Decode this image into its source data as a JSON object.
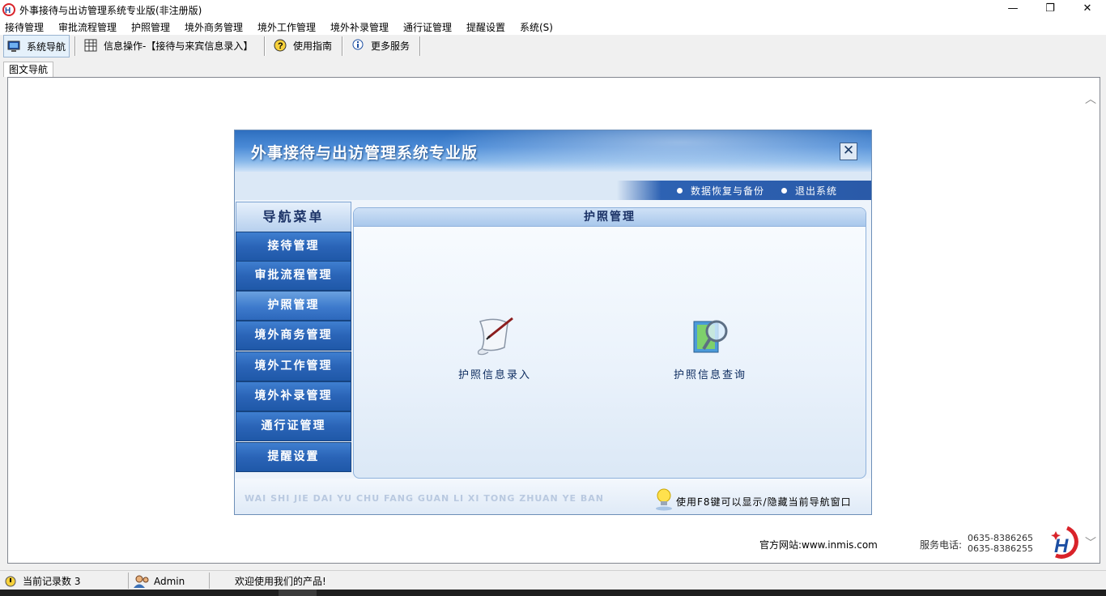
{
  "window": {
    "title": "外事接待与出访管理系统专业版(非注册版)",
    "controls": {
      "minimize": "—",
      "restore": "❐",
      "close": "✕"
    }
  },
  "menubar": [
    "接待管理",
    "审批流程管理",
    "护照管理",
    "境外商务管理",
    "境外工作管理",
    "境外补录管理",
    "通行证管理",
    "提醒设置",
    "系统(S)"
  ],
  "toolbar": {
    "nav_label": "系统导航",
    "info_label": "信息操作-【接待与来宾信息录入】",
    "guide_label": "使用指南",
    "more_label": "更多服务"
  },
  "tab": {
    "label": "图文导航"
  },
  "dialog": {
    "title": "外事接待与出访管理系统专业版",
    "close_label": "✕",
    "links": {
      "backup": "数据恢复与备份",
      "exit": "退出系统"
    },
    "nav_title": "导航菜单",
    "nav_items": [
      "接待管理",
      "审批流程管理",
      "护照管理",
      "境外商务管理",
      "境外工作管理",
      "境外补录管理",
      "通行证管理",
      "提醒设置"
    ],
    "active_nav_index": 2,
    "panel_title": "护照管理",
    "actions": {
      "entry": "护照信息录入",
      "query": "护照信息查询"
    },
    "pinyin": "WAI SHI JIE DAI YU CHU FANG GUAN LI XI TONG ZHUAN YE BAN",
    "hint": "使用F8键可以显示/隐藏当前导航窗口"
  },
  "footer": {
    "site": "官方网站:www.inmis.com",
    "phone_label": "服务电话:",
    "phone1": "0635-8386265",
    "phone2": "0635-8386255",
    "logo_text": "H"
  },
  "statusbar": {
    "records_label": "当前记录数 3",
    "user": "Admin",
    "welcome": "欢迎使用我们的产品!"
  },
  "colors": {
    "nav_button": "#2a64b7",
    "header_blue": "#2e6fbf",
    "logo_red": "#d9232a",
    "logo_blue": "#1d4fa3"
  }
}
